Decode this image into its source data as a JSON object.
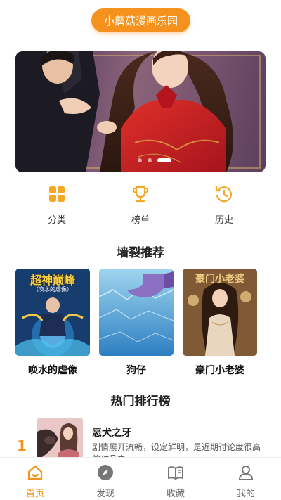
{
  "app": {
    "title": "小蘑菇漫画乐园"
  },
  "colors": {
    "accent": "#f5921e",
    "text": "#222222",
    "muted": "#666666"
  },
  "banner": {
    "slide_count": 3,
    "active_slide": 3
  },
  "quick_nav": [
    {
      "label": "分类",
      "icon": "grid-icon"
    },
    {
      "label": "榜单",
      "icon": "trophy-icon"
    },
    {
      "label": "历史",
      "icon": "history-icon"
    }
  ],
  "recommend": {
    "title": "墙裂推荐",
    "items": [
      {
        "title": "唤水的虐像",
        "cover_text": "超神巅峰",
        "cover_subtext": "（唤水的虐像）"
      },
      {
        "title": "狗仔"
      },
      {
        "title": "豪门小老婆",
        "cover_text": "豪门小老婆"
      }
    ]
  },
  "ranking": {
    "title": "热门排行榜",
    "items": [
      {
        "rank": "1",
        "title": "恶犬之牙",
        "desc": "剧情展开流畅，设定鲜明，是近期讨论度很高的作品之一。"
      }
    ]
  },
  "tabbar": [
    {
      "label": "首页",
      "icon": "home-icon",
      "active": true
    },
    {
      "label": "发现",
      "icon": "compass-icon",
      "active": false
    },
    {
      "label": "收藏",
      "icon": "book-icon",
      "active": false
    },
    {
      "label": "我的",
      "icon": "user-icon",
      "active": false
    }
  ]
}
